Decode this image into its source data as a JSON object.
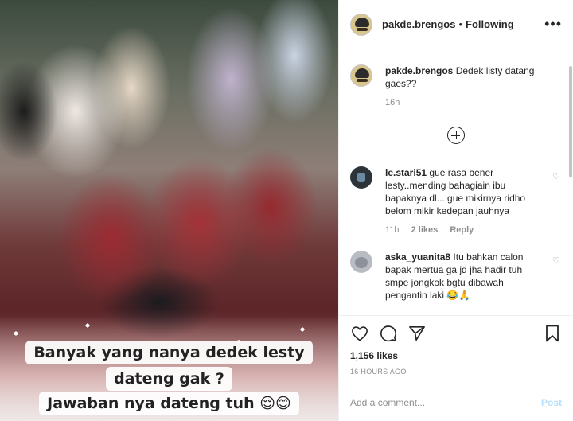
{
  "media": {
    "overlay_lines": [
      "Banyak yang nanya dedek lesty",
      "dateng gak ?",
      "Jawaban nya dateng tuh 😌😊"
    ]
  },
  "header": {
    "username": "pakde.brengos",
    "separator": "•",
    "follow_status": "Following",
    "more_icon": "more-horizontal-icon"
  },
  "caption": {
    "username": "pakde.brengos",
    "text": "Dedek listy datang gaes??",
    "time": "16h"
  },
  "comments": [
    {
      "username": "le.stari51",
      "text": "gue rasa bener lesty..mending bahagiain ibu bapaknya dl... gue mikirnya ridho belom mikir kedepan jauhnya",
      "time": "11h",
      "likes": "2 likes",
      "reply": "Reply"
    },
    {
      "username": "aska_yuanita8",
      "text": "Itu bahkan calon bapak mertua ga jd jha hadir tuh smpe jongkok bgtu dibawah pengantin laki 😂🙏",
      "time": "",
      "likes": "",
      "reply": ""
    }
  ],
  "actions": {
    "likes": "1,156 likes",
    "posted_ago": "16 HOURS AGO"
  },
  "add_comment": {
    "placeholder": "Add a comment...",
    "post_label": "Post"
  },
  "colors": {
    "text": "#262626",
    "muted": "#8e8e8e",
    "border": "#efefef",
    "post_disabled": "#b2dffc"
  }
}
